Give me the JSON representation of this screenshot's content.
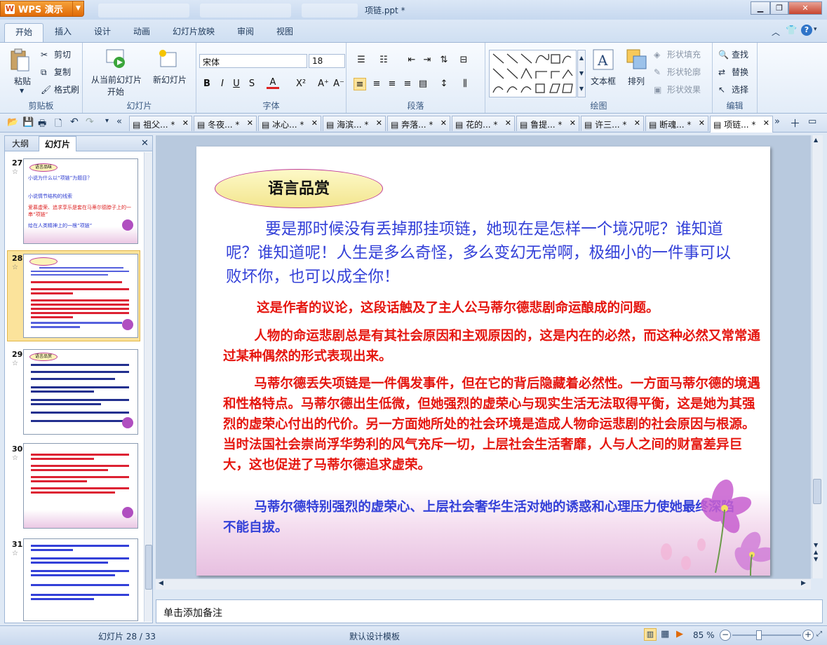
{
  "app": {
    "brand": "WPS 演示",
    "title": "项链.ppt *"
  },
  "ghost_tabs": [
    "",
    "",
    ""
  ],
  "menu": [
    "开始",
    "插入",
    "设计",
    "动画",
    "幻灯片放映",
    "审阅",
    "视图"
  ],
  "ribbon": {
    "clipboard": {
      "paste": "粘贴",
      "cut": "剪切",
      "copy": "复制",
      "format_painter": "格式刷",
      "label": "剪贴板"
    },
    "slides": {
      "from_current": "从当前幻灯片",
      "start": "开始",
      "new_slide": "新幻灯片",
      "label": "幻灯片"
    },
    "font": {
      "name": "宋体",
      "size": "18",
      "label": "字体"
    },
    "paragraph": {
      "label": "段落"
    },
    "drawing": {
      "textbox": "文本框",
      "arrange": "排列",
      "fill": "形状填充",
      "outline": "形状轮廓",
      "effect": "形状效果",
      "label": "绘图"
    },
    "edit": {
      "find": "查找",
      "replace": "替换",
      "select": "选择",
      "label": "编辑"
    }
  },
  "doc_tabs": [
    "祖父... *",
    "冬夜... *",
    "冰心... *",
    "海滨... *",
    "奔落... *",
    "花的... *",
    "鲁提... *",
    "许三... *",
    "断魂... *",
    "项链... *"
  ],
  "left_pane": {
    "tab_outline": "大纲",
    "tab_slides": "幻灯片",
    "thumbs": [
      {
        "num": "27",
        "title": "语言品味",
        "lines": [
          "小说为什么以“项链”为题目？",
          "小说情节结构的线索",
          "爱慕虚荣、追求享乐是套在马蒂尔德脖子上的一串“项链”",
          "给在人类精神上的一根“项链”"
        ]
      },
      {
        "num": "28"
      },
      {
        "num": "29",
        "title": "语言品赏"
      },
      {
        "num": "30"
      },
      {
        "num": "31"
      }
    ]
  },
  "slide": {
    "heading": "语言品赏",
    "quote": "要是那时候没有丢掉那挂项链，她现在是怎样一个境况呢？谁知道呢？谁知道呢！人生是多么奇怪，多么变幻无常啊，极细小的一件事可以败坏你，也可以成全你！",
    "p1": "这是作者的议论，这段话触及了主人公马蒂尔德悲剧命运酿成的问题。",
    "p2": "人物的命运悲剧总是有其社会原因和主观原因的，这是内在的必然，而这种必然又常常通过某种偶然的形式表现出来。",
    "p3": "马蒂尔德丢失项链是一件偶发事件，但在它的背后隐藏着必然性。一方面马蒂尔德的境遇和性格特点。马蒂尔德出生低微，但她强烈的虚荣心与现实生活无法取得平衡，这是她为其强烈的虚荣心付出的代价。另一方面她所处的社会环境是造成人物命运悲剧的社会原因与根源。当时法国社会崇尚浮华势利的风气充斥一切，上层社会生活奢靡，人与人之间的财富差异巨大，这也促进了马蒂尔德追求虚荣。",
    "p4": "马蒂尔德特别强烈的虚荣心、上层社会奢华生活对她的诱惑和心理压力使她最终深陷不能自拔。"
  },
  "notes": "单击添加备注",
  "status": {
    "slide": "幻灯片 28 / 33",
    "template": "默认设计模板",
    "zoom": "85 %"
  },
  "colors": {
    "quote": "#3340d8",
    "red": "#e5160f",
    "accent": "#f2c34a"
  }
}
